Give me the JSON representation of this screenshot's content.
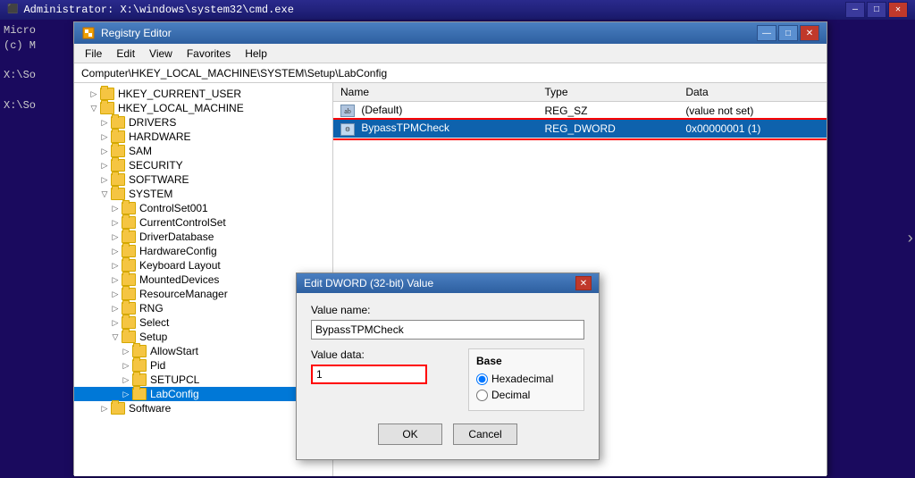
{
  "cmd": {
    "title": "Administrator: X:\\windows\\system32\\cmd.exe",
    "lines": [
      "Micro",
      "(c) M",
      "",
      "X:\\So",
      "",
      "X:\\So"
    ]
  },
  "regedit": {
    "title": "Registry Editor",
    "address": "Computer\\HKEY_LOCAL_MACHINE\\SYSTEM\\Setup\\LabConfig",
    "menu": [
      "File",
      "Edit",
      "View",
      "Favorites",
      "Help"
    ],
    "table": {
      "headers": [
        "Name",
        "Type",
        "Data"
      ],
      "rows": [
        {
          "name": "(Default)",
          "type": "REG_SZ",
          "data": "(value not set)",
          "selected": false
        },
        {
          "name": "BypassTPMCheck",
          "type": "REG_DWORD",
          "data": "0x00000001 (1)",
          "selected": true
        }
      ]
    },
    "tree": {
      "items": [
        {
          "label": "HKEY_CURRENT_USER",
          "level": 1,
          "expanded": false
        },
        {
          "label": "HKEY_LOCAL_MACHINE",
          "level": 1,
          "expanded": true
        },
        {
          "label": "DRIVERS",
          "level": 2,
          "expanded": false
        },
        {
          "label": "HARDWARE",
          "level": 2,
          "expanded": false
        },
        {
          "label": "SAM",
          "level": 2,
          "expanded": false
        },
        {
          "label": "SECURITY",
          "level": 2,
          "expanded": false
        },
        {
          "label": "SOFTWARE",
          "level": 2,
          "expanded": false
        },
        {
          "label": "SYSTEM",
          "level": 2,
          "expanded": true
        },
        {
          "label": "ControlSet001",
          "level": 3,
          "expanded": false
        },
        {
          "label": "CurrentControlSet",
          "level": 3,
          "expanded": false
        },
        {
          "label": "DriverDatabase",
          "level": 3,
          "expanded": false
        },
        {
          "label": "HardwareConfig",
          "level": 3,
          "expanded": false
        },
        {
          "label": "Keyboard Layout",
          "level": 3,
          "expanded": false
        },
        {
          "label": "MountedDevices",
          "level": 3,
          "expanded": false
        },
        {
          "label": "ResourceManager",
          "level": 3,
          "expanded": false
        },
        {
          "label": "RNG",
          "level": 3,
          "expanded": false
        },
        {
          "label": "Select",
          "level": 3,
          "expanded": false
        },
        {
          "label": "Setup",
          "level": 3,
          "expanded": true
        },
        {
          "label": "AllowStart",
          "level": 4,
          "expanded": false
        },
        {
          "label": "Pid",
          "level": 4,
          "expanded": false
        },
        {
          "label": "SETUPCL",
          "level": 4,
          "expanded": false
        },
        {
          "label": "LabConfig",
          "level": 4,
          "expanded": false,
          "selected": true
        },
        {
          "label": "Software",
          "level": 2,
          "expanded": false
        }
      ]
    }
  },
  "dialog": {
    "title": "Edit DWORD (32-bit) Value",
    "value_name_label": "Value name:",
    "value_name": "BypassTPMCheck",
    "value_data_label": "Value data:",
    "value_data": "1",
    "base_label": "Base",
    "hex_label": "Hexadecimal",
    "dec_label": "Decimal",
    "ok_label": "OK",
    "cancel_label": "Cancel",
    "hex_checked": true,
    "dec_checked": false
  },
  "titlebar_buttons": {
    "minimize": "—",
    "maximize": "□",
    "close": "✕"
  }
}
